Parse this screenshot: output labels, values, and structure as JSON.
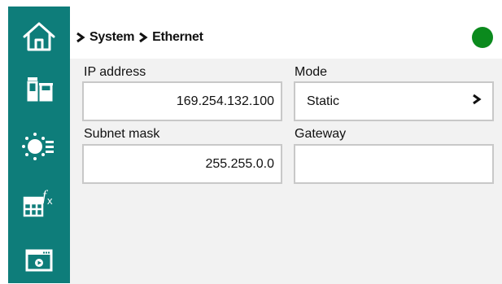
{
  "sidebar": {
    "items": [
      {
        "icon": "home-icon"
      },
      {
        "icon": "devices-icon"
      },
      {
        "icon": "sun-settings-icon"
      },
      {
        "icon": "formula-table-icon"
      },
      {
        "icon": "media-window-icon"
      }
    ]
  },
  "breadcrumb": {
    "items": [
      "System",
      "Ethernet"
    ]
  },
  "status": {
    "color": "#0b8a1d"
  },
  "form": {
    "ip_address": {
      "label": "IP address",
      "value": "169.254.132.100"
    },
    "mode": {
      "label": "Mode",
      "value": "Static"
    },
    "subnet_mask": {
      "label": "Subnet mask",
      "value": "255.255.0.0"
    },
    "gateway": {
      "label": "Gateway",
      "value": ""
    }
  }
}
